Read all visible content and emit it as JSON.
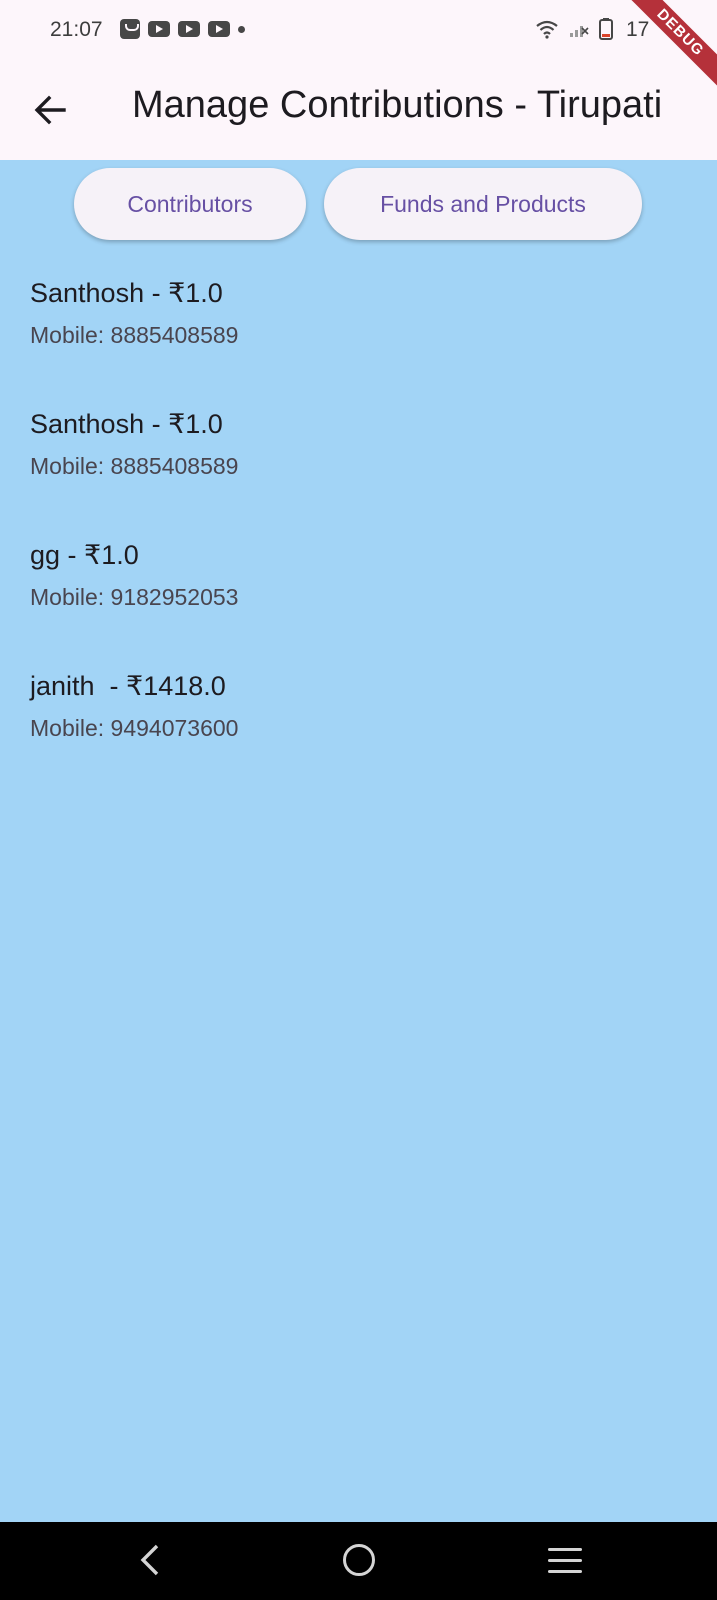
{
  "status": {
    "time": "21:07",
    "battery_text": "17",
    "icons": [
      "shopping-bag-icon",
      "youtube-icon",
      "youtube-icon",
      "youtube-icon",
      "dot-icon",
      "wifi-icon",
      "signal-icon",
      "battery-icon"
    ]
  },
  "debug_banner": "DEBUG",
  "appbar": {
    "title": "Manage Contributions - Tirupati"
  },
  "tabs": [
    {
      "label": "Contributors"
    },
    {
      "label": "Funds and Products"
    }
  ],
  "contributors": [
    {
      "title": "Santhosh - ₹1.0",
      "subtitle": "Mobile: 8885408589"
    },
    {
      "title": "Santhosh - ₹1.0",
      "subtitle": "Mobile: 8885408589"
    },
    {
      "title": "gg - ₹1.0",
      "subtitle": "Mobile: 9182952053"
    },
    {
      "title": "janith  - ₹1418.0",
      "subtitle": "Mobile: 9494073600"
    }
  ],
  "colors": {
    "background": "#a2d4f6",
    "appbar": "#fdf6fb",
    "button_text": "#6750a4",
    "debug_ribbon": "#b5313a"
  }
}
